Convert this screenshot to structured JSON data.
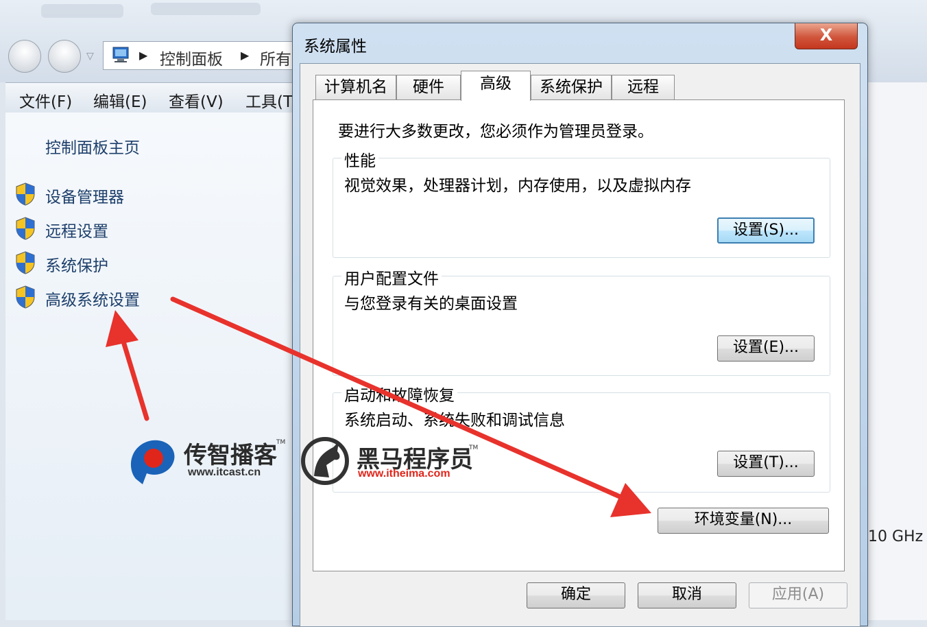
{
  "explorer": {
    "breadcrumb": [
      "控制面板",
      "所有"
    ],
    "menu": [
      "文件(F)",
      "编辑(E)",
      "查看(V)",
      "工具(T"
    ],
    "control_panel_home": "控制面板主页",
    "tasks": [
      "设备管理器",
      "远程设置",
      "系统保护",
      "高级系统设置"
    ],
    "cpu_fragment": "10 GHz"
  },
  "watermark": {
    "brand1_cn": "传智播客",
    "brand1_url": "www.itcast.cn",
    "brand2_cn": "黑马程序员",
    "brand2_url": "www.itheima.com",
    "tm": "TM"
  },
  "dialog": {
    "title": "系统属性",
    "close_glyph": "X",
    "tabs": [
      "计算机名",
      "硬件",
      "高级",
      "系统保护",
      "远程"
    ],
    "active_tab": "高级",
    "admin_note": "要进行大多数更改，您必须作为管理员登录。",
    "groups": [
      {
        "title": "性能",
        "desc": "视觉效果，处理器计划，内存使用，以及虚拟内存",
        "button": "设置(S)..."
      },
      {
        "title": "用户配置文件",
        "desc": "与您登录有关的桌面设置",
        "button": "设置(E)..."
      },
      {
        "title": "启动和故障恢复",
        "desc": "系统启动、系统失败和调试信息",
        "button": "设置(T)..."
      }
    ],
    "env_button": "环境变量(N)...",
    "ok": "确定",
    "cancel": "取消",
    "apply": "应用(A)"
  },
  "colors": {
    "annotation_arrow": "#e8322c",
    "shield_blue": "#2f6fcf",
    "shield_yellow": "#f5c422",
    "link_blue": "#1d3f6b",
    "watermark_red": "#e0261b",
    "watermark_blue": "#1a63b8"
  }
}
